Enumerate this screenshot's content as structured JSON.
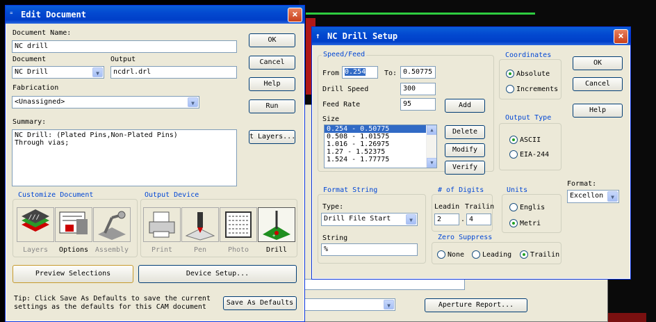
{
  "edit_document": {
    "title": "Edit Document",
    "document_name_label": "Document Name:",
    "document_name_value": "NC drill",
    "document_label": "Document",
    "document_value": "NC Drill",
    "output_label": "Output",
    "output_value": "ncdrl.drl",
    "fabrication_label": "Fabrication",
    "fabrication_value": "<Unassigned>",
    "summary_label": "Summary:",
    "summary_line1": "NC Drill: (Plated Pins,Non-Plated Pins)",
    "summary_line2": "Through vias;",
    "ok": "OK",
    "cancel": "Cancel",
    "help": "Help",
    "run": "Run",
    "select_layers": "t Layers...",
    "customize_title": "Customize Document",
    "output_device_title": "Output Device",
    "customize_items": [
      "Layers",
      "Options",
      "Assembly"
    ],
    "device_items": [
      "Print",
      "Pen",
      "Photo",
      "Drill"
    ],
    "preview_selections": "Preview Selections",
    "device_setup": "Device Setup...",
    "tip_line1": "Tip: Click Save As Defaults to save the current",
    "tip_line2": "settings as the defaults for this CAM document",
    "save_as_defaults": "Save As Defaults"
  },
  "nc_drill_setup": {
    "title": "NC Drill Setup",
    "speed_feed_title": "Speed/Feed",
    "from_label": "From",
    "from_value": "0.254",
    "to_label": "To:",
    "to_value": "0.50775",
    "drill_speed_label": "Drill Speed",
    "drill_speed_value": "300",
    "feed_rate_label": "Feed Rate",
    "feed_rate_value": "95",
    "size_label": "Size",
    "size_rows": [
      "0.254 - 0.50775",
      "0.508 - 1.01575",
      "1.016 - 1.26975",
      "1.27 - 1.52375",
      "1.524 - 1.77775"
    ],
    "add": "Add",
    "delete": "Delete",
    "modify": "Modify",
    "verify": "Verify",
    "coordinates_title": "Coordinates",
    "absolute": "Absolute",
    "incremental": "Increments",
    "ok": "OK",
    "cancel": "Cancel",
    "help": "Help",
    "output_type_title": "Output Type",
    "ascii": "ASCII",
    "eia": "EIA-244",
    "format_string_title": "Format String",
    "type_label": "Type:",
    "type_value": "Drill File Start",
    "string_label": "String",
    "string_value": "%",
    "digits_title": "# of Digits",
    "leading_label": "Leadin",
    "trailing_label": "Trailin",
    "leading_value": "2",
    "trailing_value": "4",
    "digits_sep": ".",
    "units_title": "Units",
    "english": "Englis",
    "metric": "Metri",
    "format_label": "Format:",
    "format_value": "Excellon",
    "zero_suppress_title": "Zero Suppress",
    "none": "None",
    "leading": "Leading",
    "trailing": "Trailin"
  },
  "background": {
    "aperture_report": "Aperture Report..."
  }
}
